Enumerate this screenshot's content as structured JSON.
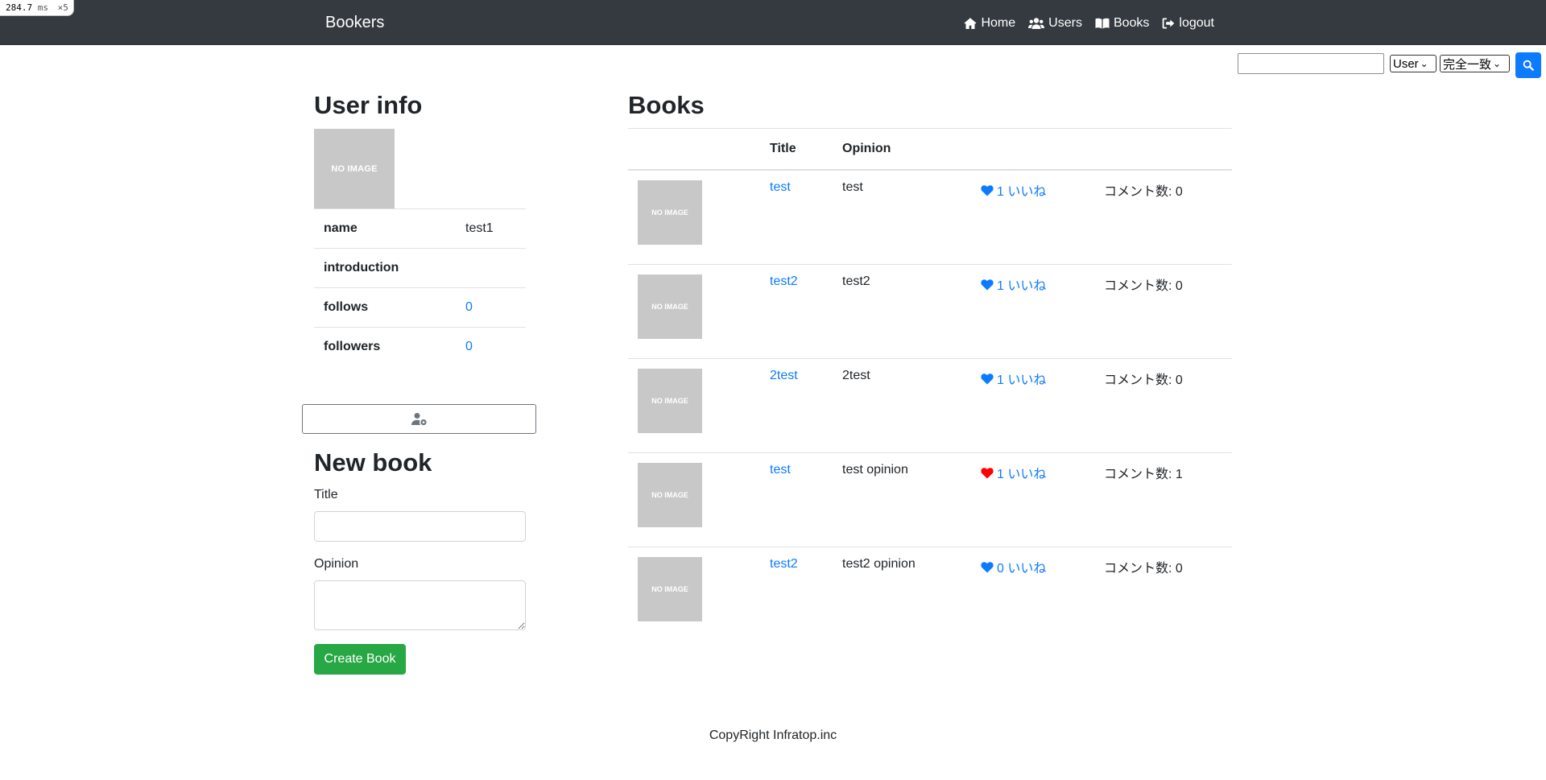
{
  "perf": {
    "value": "284.7",
    "unit": "ms",
    "multiplier": "×5"
  },
  "navbar": {
    "brand": "Bookers",
    "links": [
      {
        "label": "Home",
        "icon": "home-icon"
      },
      {
        "label": "Users",
        "icon": "users-icon"
      },
      {
        "label": "Books",
        "icon": "book-icon"
      },
      {
        "label": "logout",
        "icon": "logout-icon"
      }
    ]
  },
  "search": {
    "value": "",
    "model_selected": "User",
    "method_selected": "完全一致",
    "button_icon": "search-icon"
  },
  "user_info": {
    "heading": "User info",
    "image_text": "NO IMAGE",
    "rows": [
      {
        "label": "name",
        "value": "test1"
      },
      {
        "label": "introduction",
        "value": ""
      },
      {
        "label": "follows",
        "value": "0"
      },
      {
        "label": "followers",
        "value": "0"
      }
    ],
    "edit_icon": "user-cog-icon"
  },
  "new_book": {
    "heading": "New book",
    "title_label": "Title",
    "opinion_label": "Opinion",
    "submit_label": "Create Book"
  },
  "books": {
    "heading": "Books",
    "columns": [
      "",
      "Title",
      "Opinion",
      "",
      ""
    ],
    "rows": [
      {
        "image_text": "NO IMAGE",
        "title": "test",
        "opinion": "test",
        "favorite": "1 いいね",
        "favorited": false,
        "comments": "コメント数: 0"
      },
      {
        "image_text": "NO IMAGE",
        "title": "test2",
        "opinion": "test2",
        "favorite": "1 いいね",
        "favorited": false,
        "comments": "コメント数: 0"
      },
      {
        "image_text": "NO IMAGE",
        "title": "2test",
        "opinion": "2test",
        "favorite": "1 いいね",
        "favorited": false,
        "comments": "コメント数: 0"
      },
      {
        "image_text": "NO IMAGE",
        "title": "test",
        "opinion": "test opinion",
        "favorite": "1 いいね",
        "favorited": true,
        "comments": "コメント数: 1"
      },
      {
        "image_text": "NO IMAGE",
        "title": "test2",
        "opinion": "test2 opinion",
        "favorite": "0 いいね",
        "favorited": false,
        "comments": "コメント数: 0"
      }
    ]
  },
  "colors": {
    "link": "#0d7bff",
    "favorited_heart": "#ff0000",
    "navbar": "#343a40",
    "create_button": "#28a745"
  },
  "footer": {
    "text": "CopyRight Infratop.inc"
  }
}
